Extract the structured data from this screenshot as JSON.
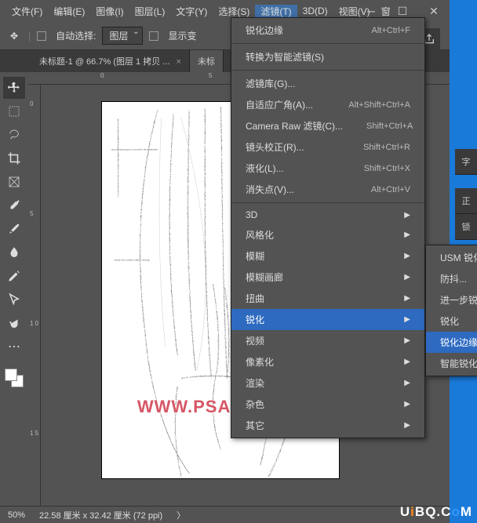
{
  "menubar": [
    "文件(F)",
    "编辑(E)",
    "图像(I)",
    "图层(L)",
    "文字(Y)",
    "选择(S)",
    "滤镜(T)",
    "3D(D)",
    "视图(V)",
    "窗"
  ],
  "active_menu_index": 6,
  "options": {
    "auto_select": "自动选择:",
    "layer_dd": "图层",
    "show_transform": "显示变"
  },
  "tabs": {
    "inactive": "未标题-1 @ 66.7% (图层 1 拷贝 ...",
    "active": "未标"
  },
  "status": {
    "zoom": "50%",
    "dims": "22.58 厘米 x 32.42 厘米 (72 ppi)"
  },
  "watermark_canvas": "WWW.PSAHZ.COM",
  "watermark_corner": {
    "t1": "U",
    "t2": "i",
    "t3": "B",
    "t4": "Q",
    "t5": ".",
    "t6": "C",
    "t7": "o",
    "t8": "M"
  },
  "filter_menu": {
    "top": {
      "label": "锐化边缘",
      "shortcut": "Alt+Ctrl+F"
    },
    "convert": "转换为智能滤镜(S)",
    "group2": [
      {
        "label": "滤镜库(G)...",
        "shortcut": ""
      },
      {
        "label": "自适应广角(A)...",
        "shortcut": "Alt+Shift+Ctrl+A"
      },
      {
        "label": "Camera Raw 滤镜(C)...",
        "shortcut": "Shift+Ctrl+A"
      },
      {
        "label": "镜头校正(R)...",
        "shortcut": "Shift+Ctrl+R"
      },
      {
        "label": "液化(L)...",
        "shortcut": "Shift+Ctrl+X"
      },
      {
        "label": "消失点(V)...",
        "shortcut": "Alt+Ctrl+V"
      }
    ],
    "group3": [
      "3D",
      "风格化",
      "模糊",
      "模糊画廊",
      "扭曲",
      "锐化",
      "视频",
      "像素化",
      "渲染",
      "杂色",
      "其它"
    ],
    "hl_index": 5
  },
  "sub_menu": {
    "items": [
      "USM 锐化",
      "防抖...",
      "进一步锐化",
      "锐化",
      "锐化边缘",
      "智能锐化"
    ],
    "hl_index": 4
  },
  "right_tabs": [
    "字",
    "正",
    "锁"
  ],
  "ruler_h": [
    "0",
    "5"
  ],
  "ruler_v": [
    "0",
    "5",
    "1 0",
    "1 5"
  ]
}
